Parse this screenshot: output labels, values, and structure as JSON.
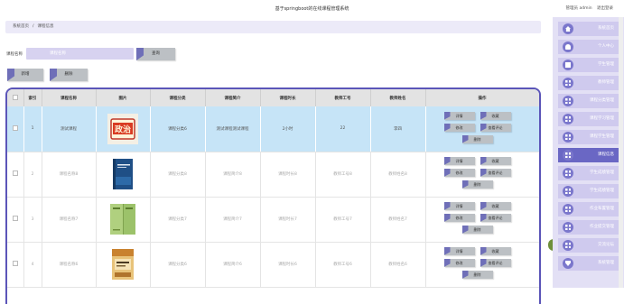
{
  "header": {
    "title": "基于springboot的在线课程管理系统",
    "user_label": "管理员 admin",
    "logout_label": "退出登录"
  },
  "breadcrumb": {
    "home": "系统首页",
    "separator": "/",
    "current": "课程信息"
  },
  "search": {
    "label": "课程名称",
    "placeholder": "课程名称",
    "button": "查询"
  },
  "toolbar": {
    "add": "新增",
    "delete": "删除"
  },
  "table": {
    "columns": [
      "索引",
      "课程名称",
      "图片",
      "课程分类",
      "课程简介",
      "课程时长",
      "教师工号",
      "教师姓名",
      "操作"
    ],
    "rows": [
      {
        "index": "1",
        "name": "测试课程",
        "image": "politics-book",
        "category": "课程分类6",
        "intro": "测试课程测试课程",
        "duration": "2小时",
        "teacher_no": "22",
        "teacher_name": "李四",
        "selected": true
      },
      {
        "index": "2",
        "name": "课程名称8",
        "image": "blue-book",
        "category": "课程分类8",
        "intro": "课程简介8",
        "duration": "课程时长8",
        "teacher_no": "教师工号8",
        "teacher_name": "教师姓名8",
        "selected": false
      },
      {
        "index": "3",
        "name": "课程名称7",
        "image": "green-book",
        "category": "课程分类7",
        "intro": "课程简介7",
        "duration": "课程时长7",
        "teacher_no": "教师工号7",
        "teacher_name": "教师姓名7",
        "selected": false
      },
      {
        "index": "4",
        "name": "课程名称6",
        "image": "yellow-book",
        "category": "课程分类6",
        "intro": "课程简介6",
        "duration": "课程时长6",
        "teacher_no": "教师工号6",
        "teacher_name": "教师姓名6",
        "selected": false
      }
    ],
    "actions": {
      "detail": "详情",
      "bookmark": "收藏",
      "edit": "修改",
      "review": "查看评论",
      "delete": "删除"
    }
  },
  "sidebar": {
    "items": [
      {
        "label": "系统首页",
        "icon": "home-icon",
        "active": false
      },
      {
        "label": "个人中心",
        "icon": "user-icon",
        "active": false
      },
      {
        "label": "学生管理",
        "icon": "square-icon",
        "active": false
      },
      {
        "label": "教师管理",
        "icon": "grid-icon",
        "active": false
      },
      {
        "label": "课程分类管理",
        "icon": "grid-icon",
        "active": false
      },
      {
        "label": "课程学习管理",
        "icon": "grid-icon",
        "active": false
      },
      {
        "label": "课程学生管理",
        "icon": "grid-icon",
        "active": false
      },
      {
        "label": "课程信息",
        "icon": "grid-icon",
        "active": true
      },
      {
        "label": "学生成绩管理",
        "icon": "grid-icon",
        "active": false
      },
      {
        "label": "学生成绩管理",
        "icon": "grid-icon",
        "active": false
      },
      {
        "label": "作业布置管理",
        "icon": "grid-icon",
        "active": false
      },
      {
        "label": "作业提交管理",
        "icon": "grid-icon",
        "active": false
      },
      {
        "label": "交流论坛",
        "icon": "grid-icon",
        "active": false
      },
      {
        "label": "系统管理",
        "icon": "diamond-icon",
        "active": false
      }
    ]
  },
  "colors": {
    "accent": "#5b55b8",
    "sidebar_bg": "#e3e0f5",
    "selected_row": "#c6e4f7"
  }
}
